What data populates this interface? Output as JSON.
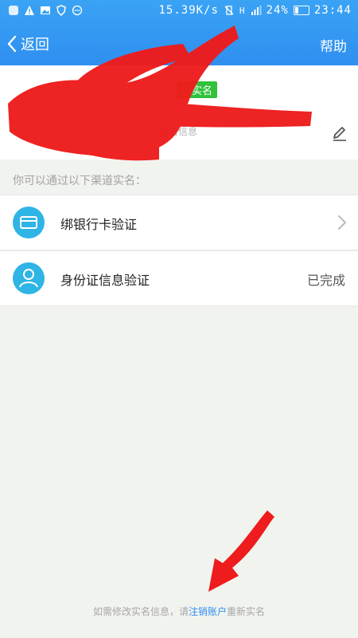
{
  "status_bar": {
    "network_speed": "15.39K/s",
    "signal": "H",
    "battery": "24%",
    "time": "23:44"
  },
  "nav": {
    "back_label": "返回",
    "title": "",
    "help_label": "帮助"
  },
  "profile": {
    "badge": "已实名",
    "subtitle": "实名信息"
  },
  "hint_label": "你可以通过以下渠道实名：",
  "items": [
    {
      "label": "绑银行卡验证",
      "right": ""
    },
    {
      "label": "身份证信息验证",
      "right": "已完成"
    }
  ],
  "footer": {
    "prefix": "如需修改实名信息，请",
    "link": "注销账户",
    "suffix": "重新实名"
  },
  "colors": {
    "accent": "#2f8ff0",
    "badge": "#31c23c",
    "redaction": "#ee1c1c"
  }
}
